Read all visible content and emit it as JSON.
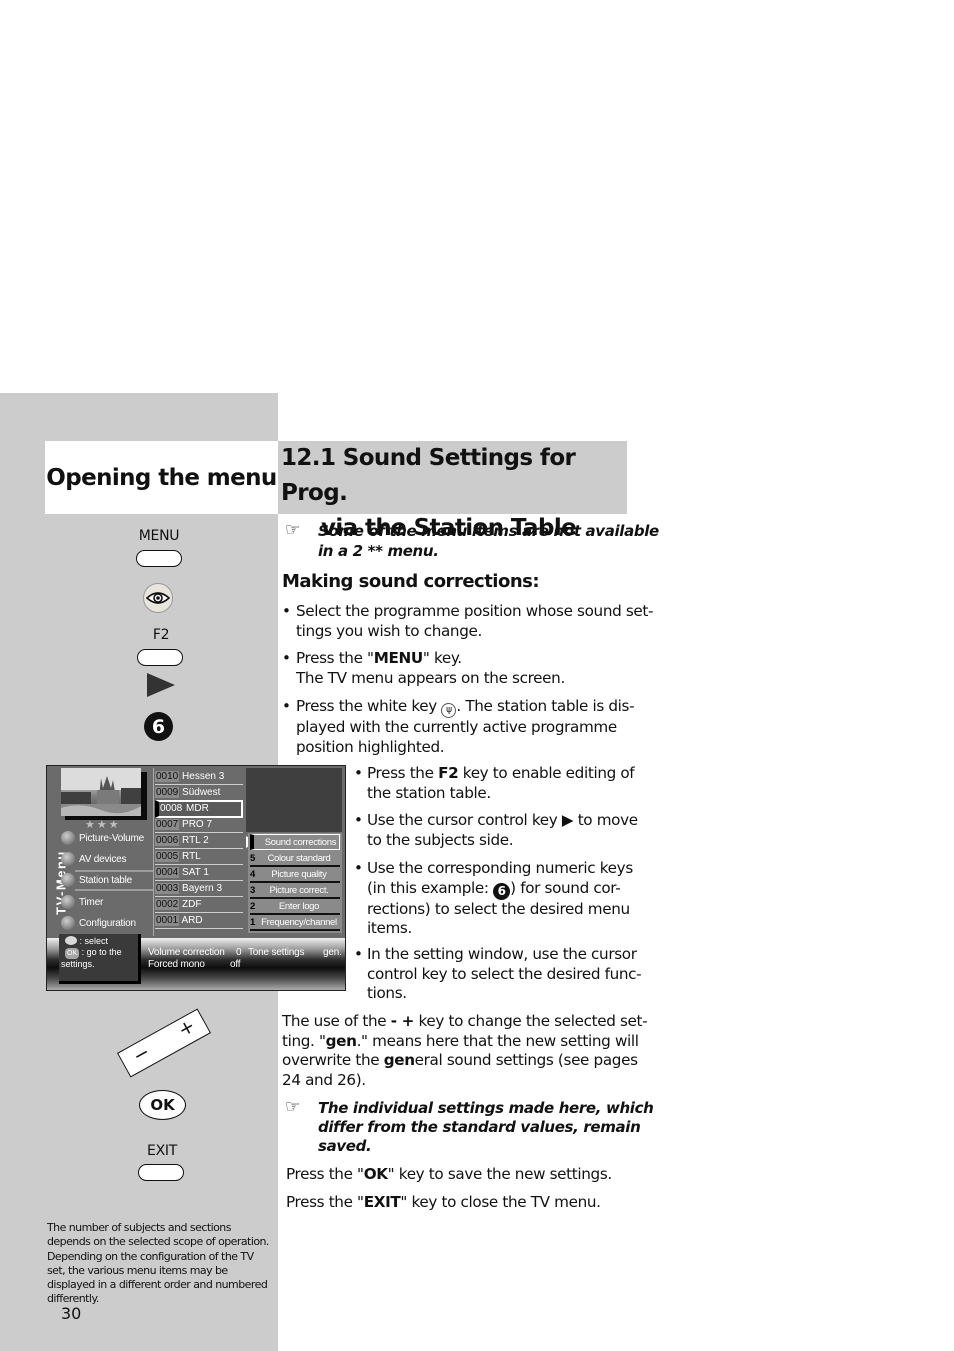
{
  "page": {
    "number": "30",
    "left_title": "Opening the menu",
    "main_title_line1": "12.1 Sound Settings for Prog.",
    "main_title_line2": "via the Station Table"
  },
  "keys": {
    "menu_label": "MENU",
    "f2_label": "F2",
    "numeric_key": "6",
    "rocker_minus": "−",
    "rocker_plus": "+",
    "ok_label": "OK",
    "exit_label": "EXIT"
  },
  "footnote": "The number of subjects and sections depends on the selected scope of operation. Depending on the configuration of the TV set, the various menu items may be displayed in a different order and numbered differently.",
  "tv_screen": {
    "vertical_label": "TV-Menu",
    "stars": "★★★",
    "menu_items": [
      "Picture-Volume",
      "AV devices",
      "Station table",
      "Timer",
      "Configuration"
    ],
    "selected_menu_item": "Station table",
    "stations": [
      {
        "num": "0010",
        "name": "Hessen 3"
      },
      {
        "num": "0009",
        "name": "Südwest"
      },
      {
        "num": "0008",
        "name": "MDR"
      },
      {
        "num": "0007",
        "name": "PRO 7"
      },
      {
        "num": "0006",
        "name": "RTL 2"
      },
      {
        "num": "0005",
        "name": "RTL"
      },
      {
        "num": "0004",
        "name": "SAT 1"
      },
      {
        "num": "0003",
        "name": "Bayern 3"
      },
      {
        "num": "0002",
        "name": "ZDF"
      },
      {
        "num": "0001",
        "name": "ARD"
      }
    ],
    "highlighted_station": "0008",
    "subjects": [
      {
        "key": "",
        "label": "Sound corrections"
      },
      {
        "key": "5",
        "label": "Colour standard"
      },
      {
        "key": "4",
        "label": "Picture quality"
      },
      {
        "key": "3",
        "label": "Picture correct."
      },
      {
        "key": "2",
        "label": "Enter logo"
      },
      {
        "key": "1",
        "label": "Frequency/channel"
      }
    ],
    "help": {
      "select_text": ": select",
      "ok_badge": "OK",
      "ok_text": ": go to the",
      "ok_text2": "settings."
    },
    "settings": {
      "volume_correction_label": "Volume correction",
      "volume_correction_value": "0",
      "tone_settings_label": "Tone settings",
      "tone_settings_value": "gen.",
      "forced_mono_label": "Forced mono",
      "forced_mono_value": "off"
    }
  },
  "content": {
    "note1_l1": "Some of the menu items are not available",
    "note1_l2": "in a 2 ** menu.",
    "heading": "Making sound corrections:",
    "b1_l1": "Select the programme position whose sound set-",
    "b1_l2": "tings you wish to change.",
    "b2_pre": "Press the \"",
    "b2_bold": "MENU",
    "b2_post": "\" key.",
    "b2_l2": "The TV menu appears on the screen.",
    "b3_pre": "Press the white key ",
    "b3_post": ". The station table is dis-",
    "b3_l2": "played with the currently active programme",
    "b3_l3": "position highlighted.",
    "b4_pre": "Press the ",
    "b4_bold": "F2",
    "b4_post": " key to enable editing of",
    "b4_l2": "the station table.",
    "b5_l1": "Use the cursor control key ▶ to move",
    "b5_l2": "to the subjects side.",
    "b6_l1": "Use the corresponding numeric keys",
    "b6_l2_pre": "(in this example: ",
    "b6_l2_num": "6",
    "b6_l2_post": ") for sound cor-",
    "b6_l3": "rections) to select the desired menu",
    "b6_l4": "items.",
    "b7_l1": "In the setting window, use the cursor",
    "b7_l2": "control key to select the desired func-",
    "b7_l3": "tions.",
    "p1_l1_pre": "The use of the ",
    "p1_l1_bold": "- +",
    "p1_l1_post": " key to change the selected set-",
    "p1_l2_pre": "ting. \"",
    "p1_l2_bold": "gen",
    "p1_l2_post": ".\" means here that the new setting will",
    "p1_l3_pre": "overwrite the ",
    "p1_l3_bold": "gen",
    "p1_l3_post": "eral sound settings (see pages",
    "p1_l4": "24 and 26).",
    "note2_l1": "The individual settings made here, which",
    "note2_l2": "differ from the standard values, remain",
    "note2_l3": "saved.",
    "p2_pre": "Press the \"",
    "p2_bold": "OK",
    "p2_post": "\" key to save the new settings.",
    "p3_pre": "Press the \"",
    "p3_bold": "EXIT",
    "p3_post": "\" key to close the TV menu.",
    "bullet_char": "•",
    "hand_icon": "☞"
  }
}
